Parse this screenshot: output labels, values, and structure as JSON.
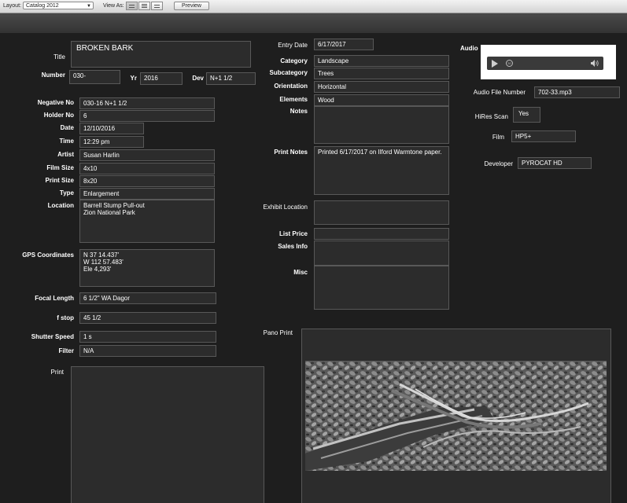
{
  "toolbar": {
    "layout_label": "Layout:",
    "layout_value": "Catalog 2012",
    "view_as_label": "View As:",
    "preview_label": "Preview"
  },
  "record": {
    "title_label": "Title",
    "title": "BROKEN BARK",
    "number_label": "Number",
    "number": "030-",
    "yr_label": "Yr",
    "yr": "2016",
    "dev_label": "Dev",
    "dev": "N+1 1/2",
    "negative_no_label": "Negative No",
    "negative_no": "030-16 N+1 1/2",
    "holder_no_label": "Holder No",
    "holder_no": "6",
    "date_label": "Date",
    "date": "12/10/2016",
    "time_label": "Time",
    "time": "12:29 pm",
    "artist_label": "Artist",
    "artist": "Susan Harlin",
    "film_size_label": "Film Size",
    "film_size": "4x10",
    "print_size_label": "Print Size",
    "print_size": "8x20",
    "type_label": "Type",
    "type": "Enlargement",
    "location_label": "Location",
    "location": "Barrell Stump Pull-out\nZion National Park",
    "gps_label": "GPS Coordinates",
    "gps": "N 37 14.437'\nW 112 57.483'\nEle 4,293'",
    "focal_length_label": "Focal Length",
    "focal_length": "6 1/2\" WA Dagor",
    "fstop_label": "f stop",
    "fstop": "45 1/2",
    "shutter_speed_label": "Shutter Speed",
    "shutter_speed": "1 s",
    "filter_label": "Filter",
    "filter": "N/A",
    "print_label": "Print",
    "entry_date_label": "Entry Date",
    "entry_date": "6/17/2017",
    "category_label": "Category",
    "category": "Landscape",
    "subcategory_label": "Subcategory",
    "subcategory": "Trees",
    "orientation_label": "Orientation",
    "orientation": "Horizontal",
    "elements_label": "Elements",
    "elements": "Wood",
    "notes_label": "Notes",
    "notes": "",
    "print_notes_label": "Print Notes",
    "print_notes": "Printed 6/17/2017 on Ilford Warmtone paper.",
    "exhibit_location_label": "Exhibit Location",
    "exhibit_location": "",
    "list_price_label": "List Price",
    "list_price": "",
    "sales_info_label": "Sales Info",
    "sales_info": "",
    "misc_label": "Misc",
    "misc": "",
    "audio_label": "Audio",
    "audio_file_number_label": "Audio File Number",
    "audio_file_number": "702-33.mp3",
    "hires_scan_label": "HiRes Scan",
    "hires_scan": "Yes",
    "film_label": "Film",
    "film": "HP5+",
    "developer_label": "Developer",
    "developer": "PYROCAT HD",
    "pano_print_label": "Pano Print"
  },
  "colors": {
    "background": "#1e1e1e",
    "field": "#2c2c2c",
    "field_border": "#585858"
  },
  "icons": [
    "play-icon",
    "rewind-icon",
    "volume-icon",
    "chevron-down-icon"
  ]
}
